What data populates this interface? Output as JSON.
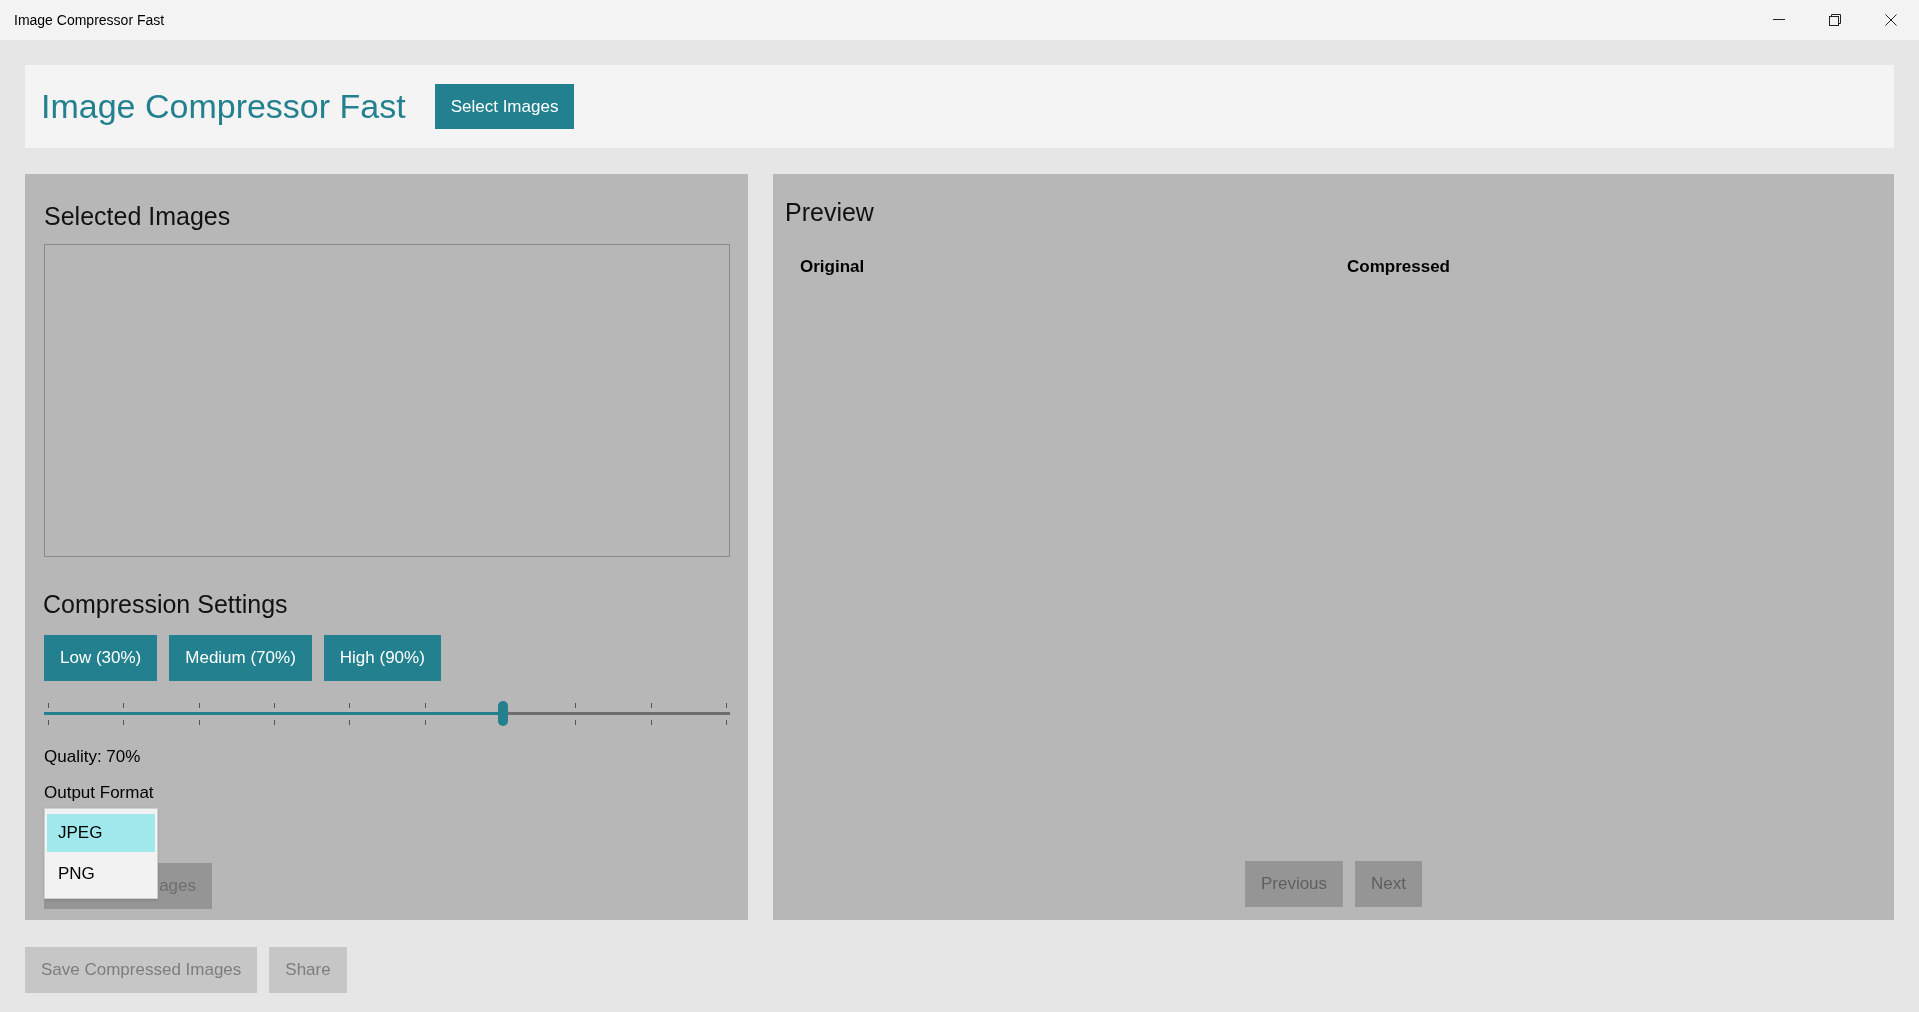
{
  "window": {
    "title": "Image Compressor Fast"
  },
  "header": {
    "title": "Image Compressor Fast",
    "select_button": "Select Images"
  },
  "selected_images": {
    "heading": "Selected Images"
  },
  "compression": {
    "heading": "Compression Settings",
    "presets": [
      "Low (30%)",
      "Medium (70%)",
      "High (90%)"
    ],
    "slider": {
      "level": 0.67
    },
    "quality_label": "Quality: 70%",
    "format_label": "Output Format",
    "format_options": [
      {
        "label": "JPEG",
        "selected": true
      },
      {
        "label": "PNG",
        "selected": false
      }
    ],
    "covered_button": {
      "label": "ages",
      "disabled": true
    }
  },
  "preview": {
    "heading": "Preview",
    "original_label": "Original",
    "compressed_label": "Compressed",
    "buttons": [
      {
        "label": "Previous",
        "disabled": true
      },
      {
        "label": "Next",
        "disabled": true
      }
    ]
  },
  "footer_buttons": [
    {
      "label": "Save Compressed Images",
      "disabled": true
    },
    {
      "label": "Share",
      "disabled": true
    }
  ]
}
